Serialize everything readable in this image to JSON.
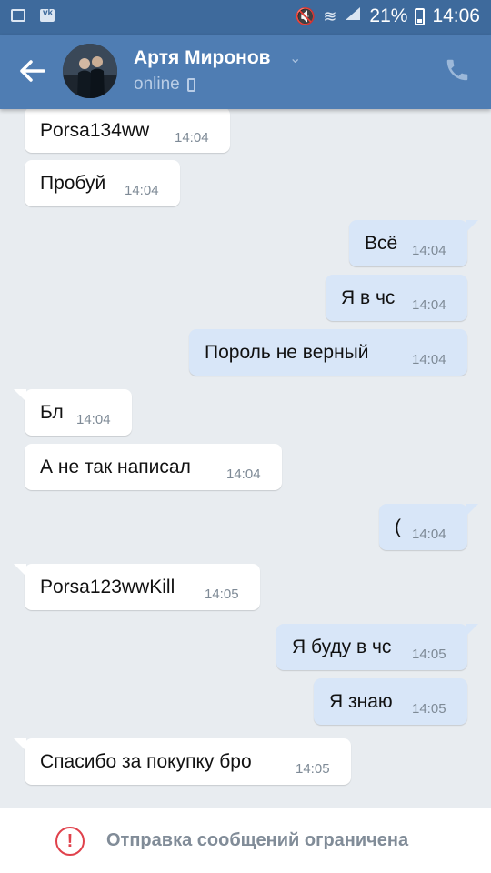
{
  "status_bar": {
    "battery": "21%",
    "time": "14:06",
    "icons": [
      "gallery-icon",
      "vk-notification-icon",
      "mute-icon",
      "wifi-icon",
      "signal-icon",
      "battery-icon"
    ]
  },
  "header": {
    "contact_name": "Артя Миронов",
    "presence": "online",
    "icons": [
      "back-arrow-icon",
      "chevron-down-icon",
      "mobile-icon",
      "phone-call-icon"
    ]
  },
  "messages": [
    {
      "text": "Porsa134ww",
      "time": "14:04",
      "direction": "incoming"
    },
    {
      "text": "Пробуй",
      "time": "14:04",
      "direction": "incoming"
    },
    {
      "text": "Всё",
      "time": "14:04",
      "direction": "outgoing"
    },
    {
      "text": "Я в чс",
      "time": "14:04",
      "direction": "outgoing"
    },
    {
      "text": "Пороль  не верный",
      "time": "14:04",
      "direction": "outgoing"
    },
    {
      "text": "Бл",
      "time": "14:04",
      "direction": "incoming"
    },
    {
      "text": "А не так написал",
      "time": "14:04",
      "direction": "incoming"
    },
    {
      "text": "(",
      "time": "14:04",
      "direction": "outgoing"
    },
    {
      "text": "Porsa123wwKill",
      "time": "14:05",
      "direction": "incoming"
    },
    {
      "text": "Я буду в чс",
      "time": "14:05",
      "direction": "outgoing"
    },
    {
      "text": "Я знаю",
      "time": "14:05",
      "direction": "outgoing"
    },
    {
      "text": "Спасибо за покупку бро",
      "time": "14:05",
      "direction": "incoming"
    }
  ],
  "bottom_bar": {
    "text": "Отправка сообщений ограничена",
    "icon": "warning-icon"
  },
  "colors": {
    "header": "#4f7db3",
    "status_bar": "#3e6a9c",
    "incoming_bubble": "#ffffff",
    "outgoing_bubble": "#d8e6f8",
    "chat_background": "#e8ecf0",
    "warning": "#e0414b"
  }
}
